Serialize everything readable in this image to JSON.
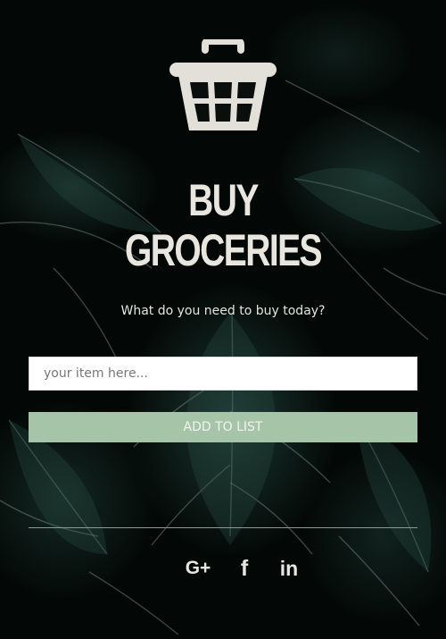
{
  "header": {
    "icon": "shopping-basket-icon",
    "title_line1": "BUY",
    "title_line2": "GROCERIES",
    "subtitle": "What do you need to buy today?"
  },
  "form": {
    "item_placeholder": "your item here...",
    "add_button_label": "ADD TO LIST"
  },
  "social": {
    "google": {
      "icon": "google-plus-icon",
      "glyph": "G+"
    },
    "facebook": {
      "icon": "facebook-icon",
      "glyph": "f"
    },
    "linkedin": {
      "icon": "linkedin-icon",
      "glyph": "in"
    }
  },
  "colors": {
    "accent_button": "#a6c4a8",
    "text_light": "#e8e6df",
    "background": "#030806"
  }
}
